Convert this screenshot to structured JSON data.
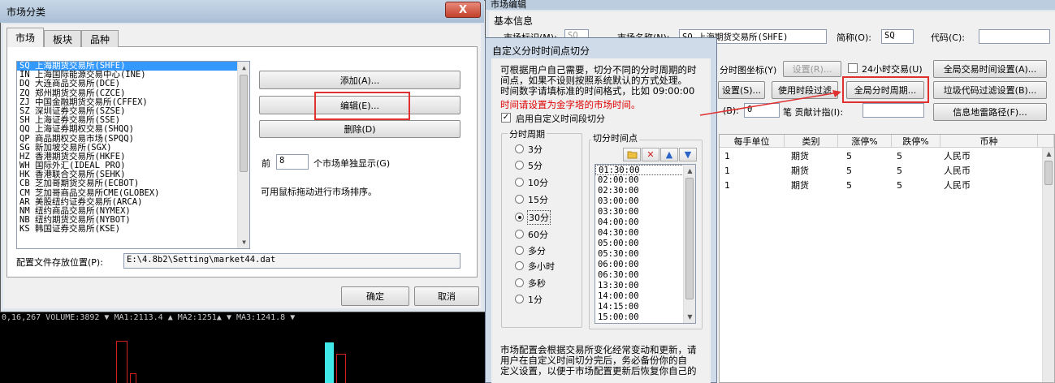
{
  "chart_area": {
    "header_text": "0,16,267 VOLUME:3892 ▼ MA1:2113.4 ▲ MA2:1251▲ ▼ MA3:1241.8 ▼"
  },
  "market_dialog": {
    "title": "市场分类",
    "close": "X",
    "tabs": [
      "市场",
      "板块",
      "品种"
    ],
    "markets": [
      "SQ 上海期货交易所(SHFE)",
      "IN 上海国际能源交易中心(INE)",
      "DQ 大连商品交易所(DCE)",
      "ZQ 郑州期货交易所(CZCE)",
      "ZJ 中国金融期货交易所(CFFEX)",
      "SZ 深圳证券交易所(SZSE)",
      "SH 上海证券交易所(SSE)",
      "QQ 上海证券期权交易(SHQQ)",
      "QP 商品期权交易市场(SPQQ)",
      "SG 新加坡交易所(SGX)",
      "HZ 香港期货交易所(HKFE)",
      "WH 国际外汇(IDEAL PRO)",
      "HK 香港联合交易所(SEHK)",
      "CB 芝加哥期货交易所(ECBOT)",
      "CM 芝加哥商品交易所CME(GLOBEX)",
      "AR 美股纽约证券交易所(ARCA)",
      "NM 纽约商品交易所(NYMEX)",
      "NB 纽约期货交易所(NYBOT)",
      "KS 韩国证券交易所(KSE)"
    ],
    "add_label": "添加(A)...",
    "edit_label": "编辑(E)...",
    "delete_label": "删除(D)",
    "front_label": "前",
    "front_value": "8",
    "front_suffix": "个市场单独显示(G)",
    "drag_hint": "可用鼠标拖动进行市场排序。",
    "config_label": "配置文件存放位置(P):",
    "config_path": "E:\\4.8b2\\Setting\\market44.dat",
    "ok_label": "确定",
    "cancel_label": "取消"
  },
  "custom_dialog": {
    "title": "自定义分时时间点切分",
    "desc_line1": "可根据用户自己需要，切分不同的分时周期的时",
    "desc_line2": "间点，如果不设则按照系统默认的方式处理。",
    "desc_line3": "时间数字请填标准的时间格式，比如 09:00:00",
    "warning": "时间请设置为金字塔的市场时间。",
    "enable_label": "启用自定义时间段切分",
    "period_group": "分时周期",
    "periods": [
      "3分",
      "5分",
      "10分",
      "15分",
      "30分",
      "60分",
      "多分",
      "多小时",
      "多秒",
      "1分"
    ],
    "selected_period": "30分",
    "points_group": "切分时间点",
    "times": [
      "01:30:00",
      "02:00:00",
      "02:30:00",
      "03:00:00",
      "03:30:00",
      "04:00:00",
      "04:30:00",
      "05:00:00",
      "05:30:00",
      "06:00:00",
      "06:30:00",
      "13:30:00",
      "14:00:00",
      "14:15:00",
      "15:00:00"
    ],
    "footer_line1": "市场配置会根据交易所变化经常变动和更新，请",
    "footer_line2": "用户在自定义时间切分完后，务必备份你的自",
    "footer_line3": "定义设置，以便于市场配置更新后恢复你自己的"
  },
  "market_edit": {
    "title": "市场编辑",
    "basic_info": "基本信息",
    "market_id_label": "市场标识(M):",
    "market_id_value": "SQ",
    "market_name_label": "市场名称(N):",
    "market_name_value": "SQ 上海期货交易所(SHFE)",
    "short_label": "简称(O):",
    "short_value": "SQ",
    "code_label": "代码(C):",
    "code_value": "",
    "chart_coord_label": "分时图坐标(Y)",
    "settings_label": "设置(R)...",
    "h24_label": "24小时交易(U)",
    "global_time_label": "全局交易时间设置(A)...",
    "settings2_label": "设置(S)...",
    "use_filter_label": "使用时段过滤",
    "global_period_label": "全局分时周期...",
    "garbage_filter_label": "垃圾代码过滤设置(B)...",
    "b_label": "(B):",
    "b_value": "0",
    "contrib_label": "笔  贡献计指(I):",
    "contrib_value": "",
    "info_path_label": "信息地雷路径(F)...",
    "columns": [
      "每手单位",
      "类别",
      "涨停%",
      "跌停%",
      "币种"
    ],
    "rows": [
      [
        "1",
        "期货",
        "5",
        "5",
        "人民币"
      ],
      [
        "1",
        "期货",
        "5",
        "5",
        "人民币"
      ],
      [
        "1",
        "期货",
        "5",
        "5",
        "人民币"
      ]
    ]
  }
}
